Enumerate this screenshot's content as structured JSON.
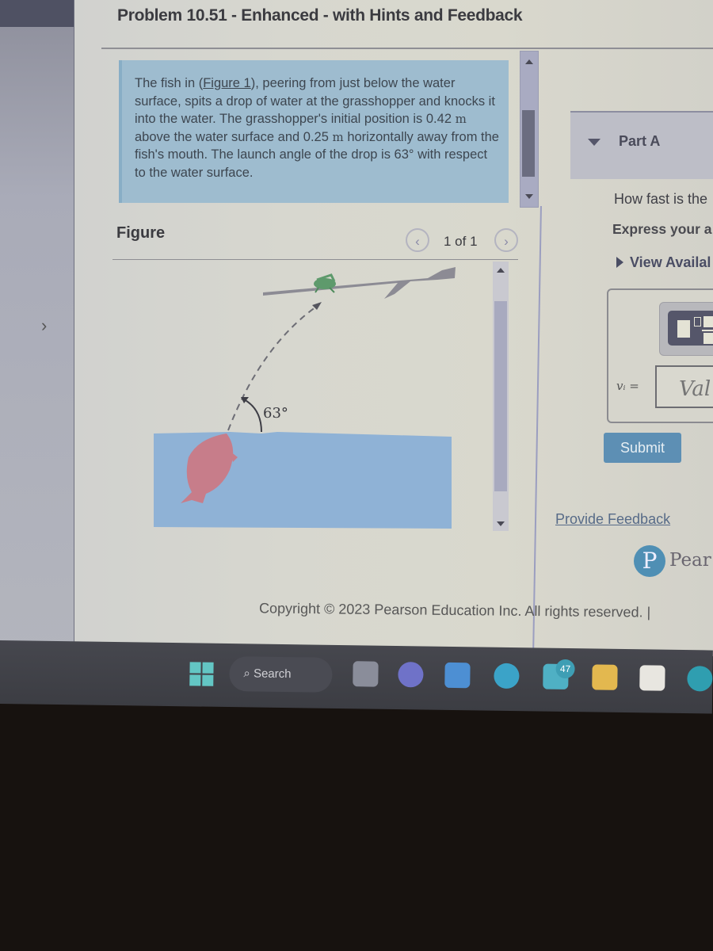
{
  "header": {
    "title": "Problem 10.51 - Enhanced - with Hints and Feedback"
  },
  "problem": {
    "text_before_link": "The fish in (",
    "figure_link": "Figure 1",
    "text_after_link": "), peering from just below the water surface, spits a drop of water at the grasshopper and knocks it into the water. The grasshopper's initial position is 0.42 ",
    "unit_1": "m",
    "text_mid": " above the water surface and 0.25 ",
    "unit_2": "m",
    "text_end": " horizontally away from the fish's mouth. The launch angle of the drop is 63° with respect to the water surface."
  },
  "figure": {
    "label": "Figure",
    "counter": "1 of 1",
    "prev_icon": "‹",
    "next_icon": "›",
    "angle_label": "63°"
  },
  "part_a": {
    "header": "Part A",
    "question": "How fast is the",
    "instruction": "Express your a",
    "view_available": "View Availal",
    "variable_label": "vᵢ =",
    "input_placeholder": "Val",
    "submit_label": "Submit"
  },
  "footer": {
    "feedback_link": "Provide Feedback",
    "brand": "Pear",
    "brand_logo": "P",
    "copyright": "Copyright © 2023 Pearson Education Inc. All rights reserved. |"
  },
  "taskbar": {
    "search_label": "Search",
    "mail_badge": "47",
    "apps": [
      "start-menu",
      "search",
      "task-view",
      "teams-meet",
      "dropbox",
      "edge",
      "mail",
      "file-explorer",
      "microsoft-store",
      "app"
    ]
  },
  "colors": {
    "problem_box": "#9ebccf",
    "submit": "#5d8fb4",
    "water": "#8fb2d6",
    "fish": "#c77d8a",
    "grasshopper": "#5e9a6c"
  }
}
